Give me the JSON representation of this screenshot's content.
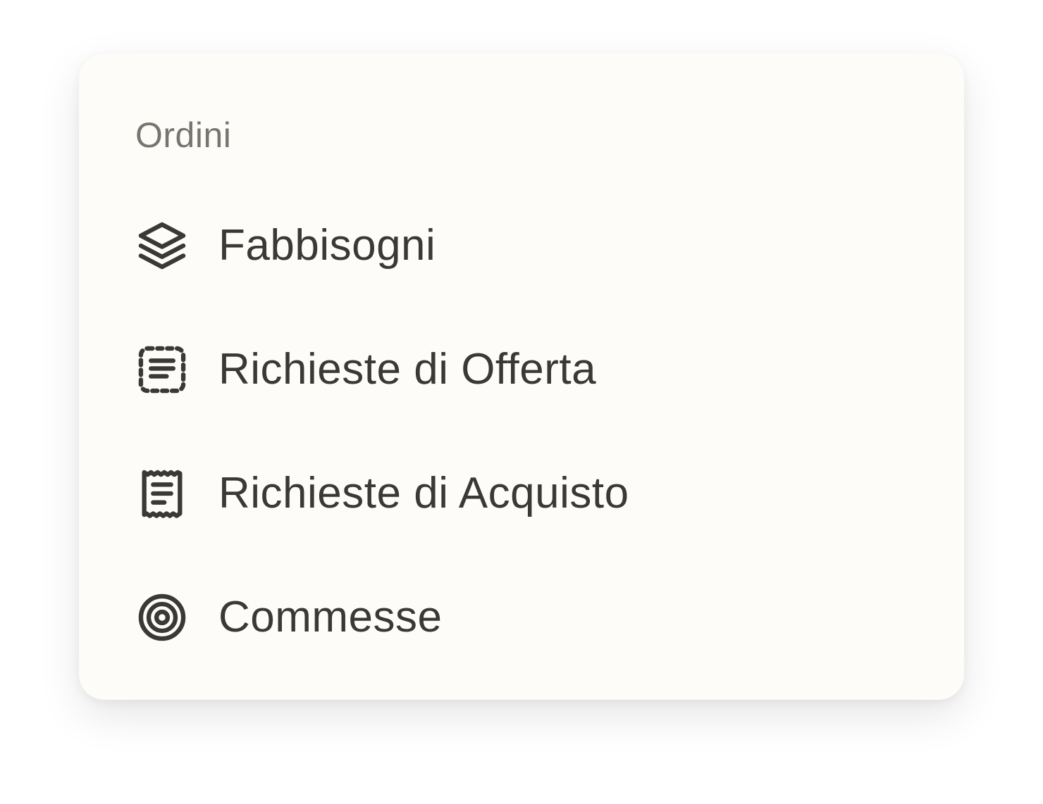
{
  "menu": {
    "section_title": "Ordini",
    "items": [
      {
        "label": "Fabbisogni",
        "icon": "stack-layers-icon"
      },
      {
        "label": "Richieste di Offerta",
        "icon": "dashed-document-lines-icon"
      },
      {
        "label": "Richieste di Acquisto",
        "icon": "receipt-icon"
      },
      {
        "label": "Commesse",
        "icon": "target-icon"
      }
    ]
  },
  "colors": {
    "card_background": "#fdfcf8",
    "section_title": "#77756f",
    "item_text": "#3a3935",
    "icon_stroke": "#3a3935"
  }
}
